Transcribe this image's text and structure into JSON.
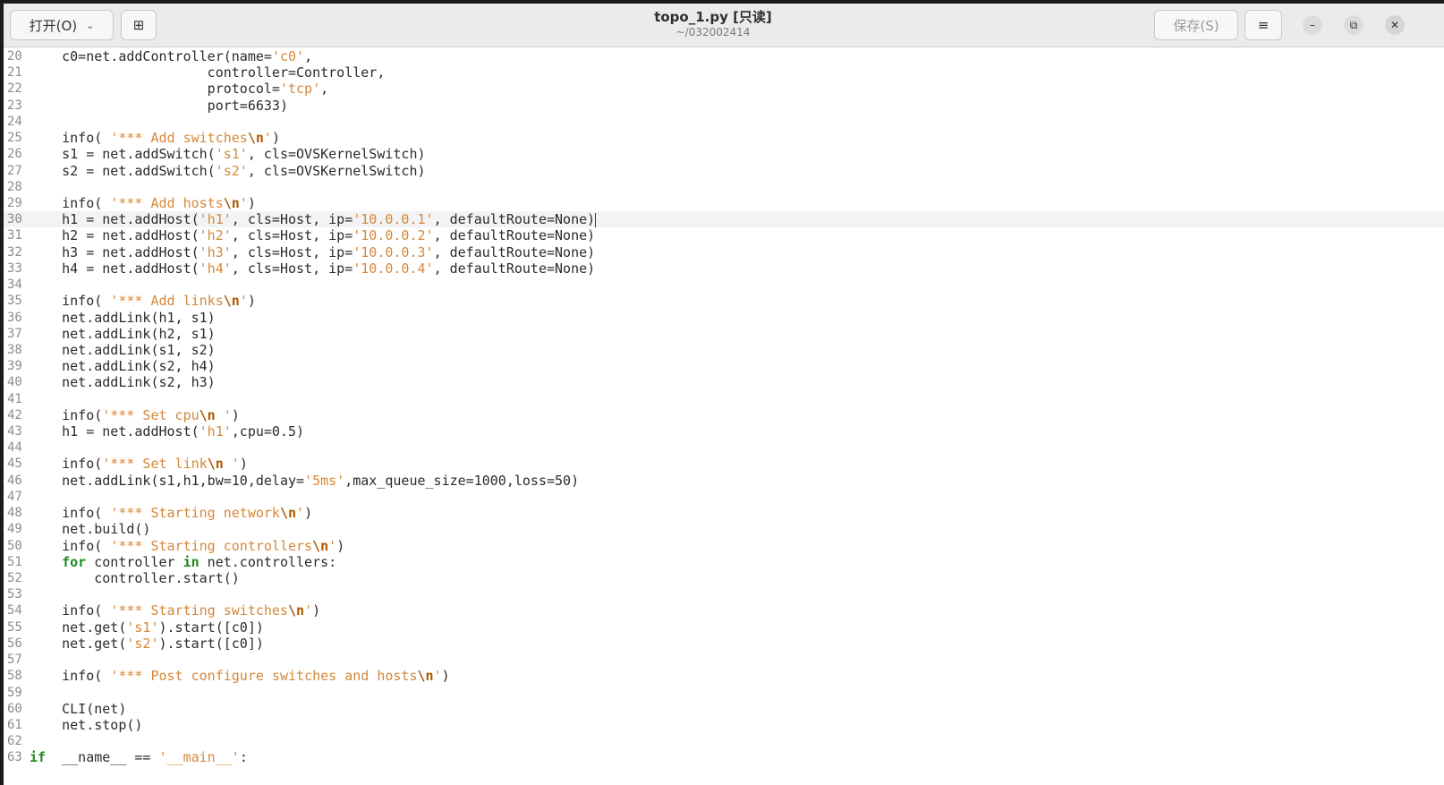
{
  "toolbar": {
    "open_label": "打开(O)",
    "open_chevron": "⌄",
    "newdoc_icon": "⊞",
    "save_label": "保存(S)",
    "menu_icon": "≡"
  },
  "window": {
    "title": "topo_1.py [只读]",
    "subtitle": "~/032002414",
    "controls": {
      "minimize": "–",
      "maximize": "⧉",
      "close": "✕"
    }
  },
  "colors": {
    "string": "#d4883a",
    "keyword": "#1f8a1f",
    "escape": "#b05900",
    "text": "#2b2b2b",
    "line_number": "#8c8c8c",
    "current_line": "#f3f3f3"
  },
  "editor": {
    "current_line": 30,
    "lines": [
      {
        "n": "20",
        "t": [
          [
            "",
            "    c0=net.addController(name="
          ],
          [
            "s",
            "'c0'"
          ],
          [
            "",
            ",  "
          ]
        ]
      },
      {
        "n": "21",
        "t": [
          [
            "",
            "                      controller=Controller,"
          ]
        ]
      },
      {
        "n": "22",
        "t": [
          [
            "",
            "                      protocol="
          ],
          [
            "s",
            "'tcp'"
          ],
          [
            "",
            ","
          ]
        ]
      },
      {
        "n": "23",
        "t": [
          [
            "",
            "                      port=6633)"
          ]
        ]
      },
      {
        "n": "24",
        "t": []
      },
      {
        "n": "25",
        "t": [
          [
            "",
            "    info( "
          ],
          [
            "s",
            "'*** Add switches"
          ],
          [
            "e",
            "\\n"
          ],
          [
            "s",
            "'"
          ],
          [
            "",
            ")"
          ]
        ]
      },
      {
        "n": "26",
        "t": [
          [
            "",
            "    s1 = net.addSwitch("
          ],
          [
            "s",
            "'s1'"
          ],
          [
            "",
            ", cls=OVSKernelSwitch)"
          ]
        ]
      },
      {
        "n": "27",
        "t": [
          [
            "",
            "    s2 = net.addSwitch("
          ],
          [
            "s",
            "'s2'"
          ],
          [
            "",
            ", cls=OVSKernelSwitch)"
          ]
        ]
      },
      {
        "n": "28",
        "t": []
      },
      {
        "n": "29",
        "t": [
          [
            "",
            "    info( "
          ],
          [
            "s",
            "'*** Add hosts"
          ],
          [
            "e",
            "\\n"
          ],
          [
            "s",
            "'"
          ],
          [
            "",
            ")"
          ]
        ]
      },
      {
        "n": "30",
        "t": [
          [
            "",
            "    h1 = net.addHost("
          ],
          [
            "s",
            "'h1'"
          ],
          [
            "",
            ", cls=Host, ip="
          ],
          [
            "s",
            "'10.0.0.1'"
          ],
          [
            "",
            ", defaultRoute=None)"
          ],
          [
            "caret",
            ""
          ]
        ]
      },
      {
        "n": "31",
        "t": [
          [
            "",
            "    h2 = net.addHost("
          ],
          [
            "s",
            "'h2'"
          ],
          [
            "",
            ", cls=Host, ip="
          ],
          [
            "s",
            "'10.0.0.2'"
          ],
          [
            "",
            ", defaultRoute=None)"
          ]
        ]
      },
      {
        "n": "32",
        "t": [
          [
            "",
            "    h3 = net.addHost("
          ],
          [
            "s",
            "'h3'"
          ],
          [
            "",
            ", cls=Host, ip="
          ],
          [
            "s",
            "'10.0.0.3'"
          ],
          [
            "",
            ", defaultRoute=None)"
          ]
        ]
      },
      {
        "n": "33",
        "t": [
          [
            "",
            "    h4 = net.addHost("
          ],
          [
            "s",
            "'h4'"
          ],
          [
            "",
            ", cls=Host, ip="
          ],
          [
            "s",
            "'10.0.0.4'"
          ],
          [
            "",
            ", defaultRoute=None)"
          ]
        ]
      },
      {
        "n": "34",
        "t": []
      },
      {
        "n": "35",
        "t": [
          [
            "",
            "    info( "
          ],
          [
            "s",
            "'*** Add links"
          ],
          [
            "e",
            "\\n"
          ],
          [
            "s",
            "'"
          ],
          [
            "",
            ")"
          ]
        ]
      },
      {
        "n": "36",
        "t": [
          [
            "",
            "    net.addLink(h1, s1)"
          ]
        ]
      },
      {
        "n": "37",
        "t": [
          [
            "",
            "    net.addLink(h2, s1)"
          ]
        ]
      },
      {
        "n": "38",
        "t": [
          [
            "",
            "    net.addLink(s1, s2)"
          ]
        ]
      },
      {
        "n": "39",
        "t": [
          [
            "",
            "    net.addLink(s2, h4)"
          ]
        ]
      },
      {
        "n": "40",
        "t": [
          [
            "",
            "    net.addLink(s2, h3)"
          ]
        ]
      },
      {
        "n": "41",
        "t": []
      },
      {
        "n": "42",
        "t": [
          [
            "",
            "    info("
          ],
          [
            "s",
            "'*** Set cpu"
          ],
          [
            "e",
            "\\n"
          ],
          [
            "s",
            " '"
          ],
          [
            "",
            ")"
          ]
        ]
      },
      {
        "n": "43",
        "t": [
          [
            "",
            "    h1 = net.addHost("
          ],
          [
            "s",
            "'h1'"
          ],
          [
            "",
            ",cpu=0.5)"
          ]
        ]
      },
      {
        "n": "44",
        "t": []
      },
      {
        "n": "45",
        "t": [
          [
            "",
            "    info("
          ],
          [
            "s",
            "'*** Set link"
          ],
          [
            "e",
            "\\n"
          ],
          [
            "s",
            " '"
          ],
          [
            "",
            ")"
          ]
        ]
      },
      {
        "n": "46",
        "t": [
          [
            "",
            "    net.addLink(s1,h1,bw=10,delay="
          ],
          [
            "s",
            "'5ms'"
          ],
          [
            "",
            ",max_queue_size=1000,loss=50)"
          ]
        ]
      },
      {
        "n": "47",
        "t": []
      },
      {
        "n": "48",
        "t": [
          [
            "",
            "    info( "
          ],
          [
            "s",
            "'*** Starting network"
          ],
          [
            "e",
            "\\n"
          ],
          [
            "s",
            "'"
          ],
          [
            "",
            ")"
          ]
        ]
      },
      {
        "n": "49",
        "t": [
          [
            "",
            "    net.build()"
          ]
        ]
      },
      {
        "n": "50",
        "t": [
          [
            "",
            "    info( "
          ],
          [
            "s",
            "'*** Starting controllers"
          ],
          [
            "e",
            "\\n"
          ],
          [
            "s",
            "'"
          ],
          [
            "",
            ")"
          ]
        ]
      },
      {
        "n": "51",
        "t": [
          [
            "",
            "    "
          ],
          [
            "k",
            "for"
          ],
          [
            "",
            " controller "
          ],
          [
            "k",
            "in"
          ],
          [
            "",
            " net.controllers:"
          ]
        ]
      },
      {
        "n": "52",
        "t": [
          [
            "",
            "        controller.start()"
          ]
        ]
      },
      {
        "n": "53",
        "t": []
      },
      {
        "n": "54",
        "t": [
          [
            "",
            "    info( "
          ],
          [
            "s",
            "'*** Starting switches"
          ],
          [
            "e",
            "\\n"
          ],
          [
            "s",
            "'"
          ],
          [
            "",
            ")"
          ]
        ]
      },
      {
        "n": "55",
        "t": [
          [
            "",
            "    net.get("
          ],
          [
            "s",
            "'s1'"
          ],
          [
            "",
            ").start([c0])"
          ]
        ]
      },
      {
        "n": "56",
        "t": [
          [
            "",
            "    net.get("
          ],
          [
            "s",
            "'s2'"
          ],
          [
            "",
            ").start([c0])"
          ]
        ]
      },
      {
        "n": "57",
        "t": []
      },
      {
        "n": "58",
        "t": [
          [
            "",
            "    info( "
          ],
          [
            "s",
            "'*** Post configure switches and hosts"
          ],
          [
            "e",
            "\\n"
          ],
          [
            "s",
            "'"
          ],
          [
            "",
            ")"
          ]
        ]
      },
      {
        "n": "59",
        "t": []
      },
      {
        "n": "60",
        "t": [
          [
            "",
            "    CLI(net)"
          ]
        ]
      },
      {
        "n": "61",
        "t": [
          [
            "",
            "    net.stop()"
          ]
        ]
      },
      {
        "n": "62",
        "t": []
      },
      {
        "n": "63",
        "t": [
          [
            "k",
            "if"
          ],
          [
            "",
            "  __name__ == "
          ],
          [
            "s",
            "'__main__'"
          ],
          [
            "",
            ":"
          ]
        ]
      }
    ]
  }
}
